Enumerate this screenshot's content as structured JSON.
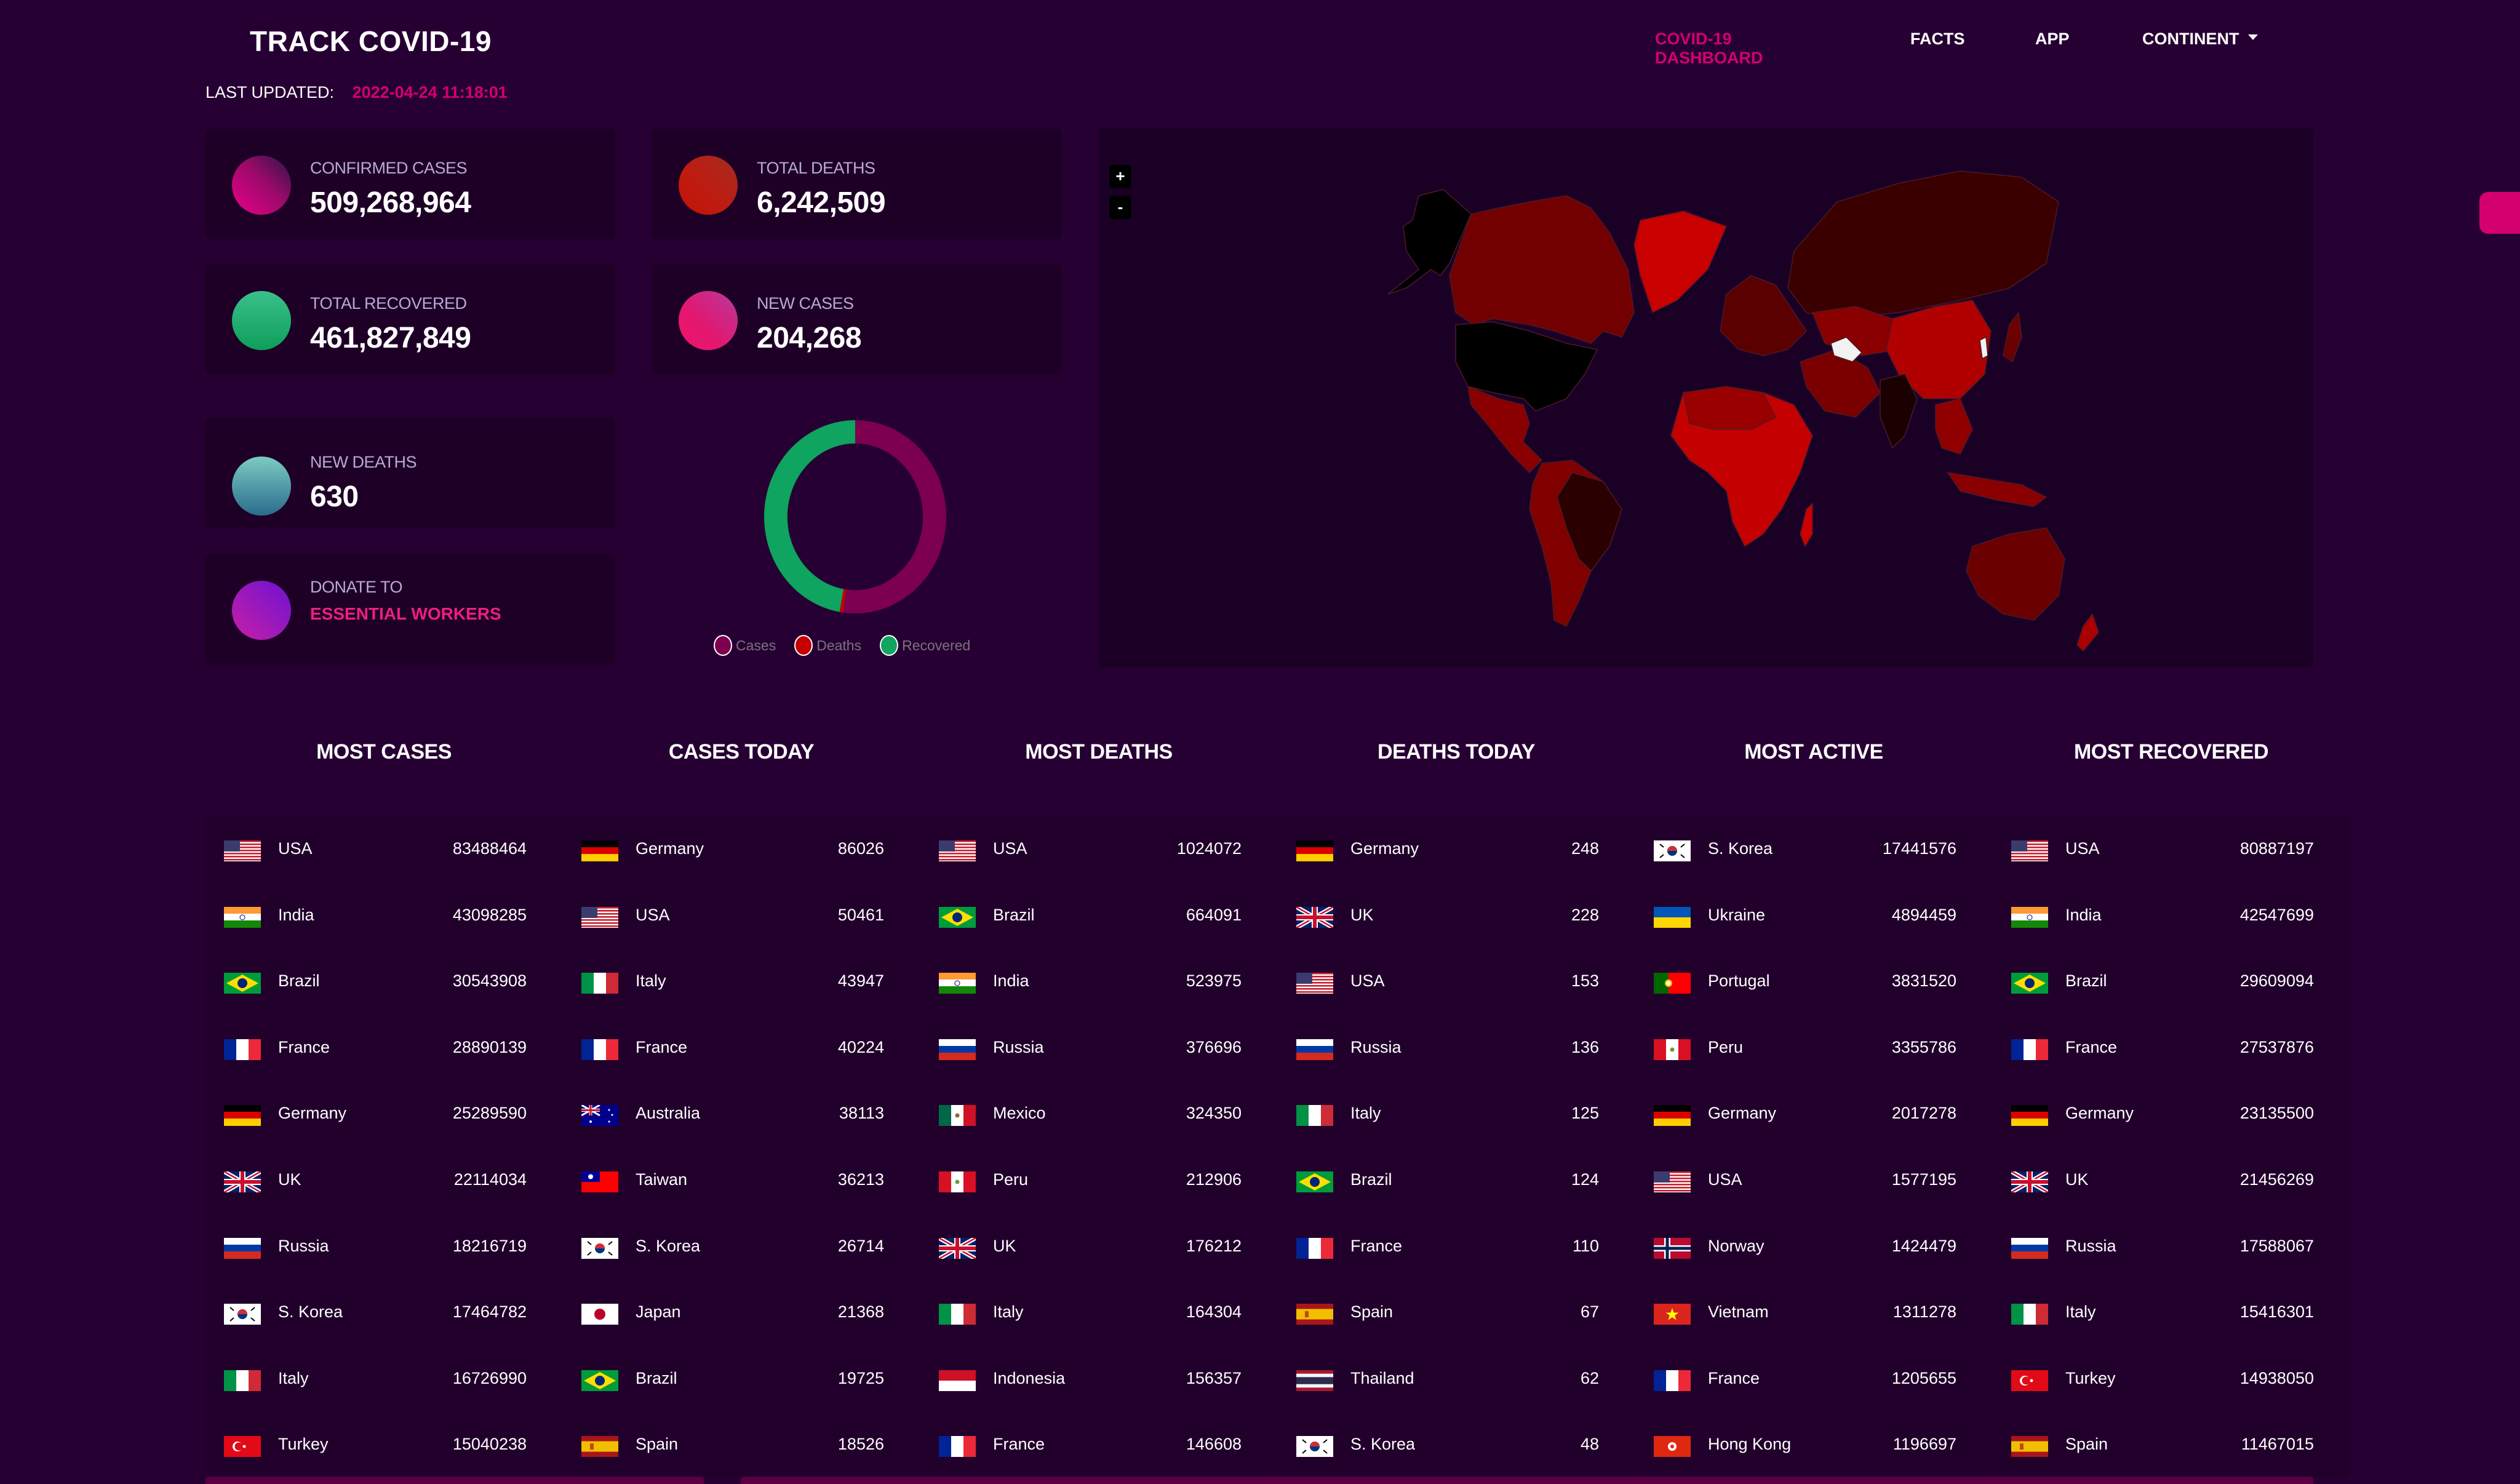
{
  "header": {
    "title": "TRACK COVID-19",
    "last_updated_label": "LAST UPDATED:",
    "last_updated_value": "2022-04-24 11:18:01"
  },
  "nav": [
    {
      "label": "COVID-19 DASHBOARD",
      "active": true
    },
    {
      "label": "FACTS",
      "active": false
    },
    {
      "label": "APP",
      "active": false
    },
    {
      "label": "CONTINENT",
      "active": false,
      "dropdown": true
    }
  ],
  "stats": {
    "confirmed": {
      "label": "CONFIRMED CASES",
      "value": "509,268,964"
    },
    "deaths": {
      "label": "TOTAL DEATHS",
      "value": "6,242,509"
    },
    "recovered": {
      "label": "TOTAL RECOVERED",
      "value": "461,827,849"
    },
    "new_cases": {
      "label": "NEW CASES",
      "value": "204,268"
    },
    "new_deaths": {
      "label": "NEW DEATHS",
      "value": "630"
    },
    "donate": {
      "label": "DONATE TO",
      "link": "ESSENTIAL WORKERS"
    }
  },
  "colors": {
    "accent": "#d4006e",
    "background": "#270033",
    "card": "#1e0026",
    "cases": "#7d0050",
    "deaths": "#c40000",
    "recovered": "#0fa45f"
  },
  "chart_data": {
    "type": "pie",
    "variant": "donut",
    "title": "",
    "legend_position": "bottom",
    "labels": [
      "Cases",
      "Deaths",
      "Recovered"
    ],
    "values": [
      509268964,
      6242509,
      461827849
    ],
    "colors": [
      "#7d0050",
      "#c40000",
      "#0fa45f"
    ]
  },
  "map": {
    "zoom_in_label": "+",
    "zoom_out_label": "-"
  },
  "lists": [
    {
      "title": "MOST CASES",
      "rows": [
        {
          "flag": "us",
          "country": "USA",
          "value": "83488464"
        },
        {
          "flag": "in",
          "country": "India",
          "value": "43098285"
        },
        {
          "flag": "br",
          "country": "Brazil",
          "value": "30543908"
        },
        {
          "flag": "fr",
          "country": "France",
          "value": "28890139"
        },
        {
          "flag": "de",
          "country": "Germany",
          "value": "25289590"
        },
        {
          "flag": "gb",
          "country": "UK",
          "value": "22114034"
        },
        {
          "flag": "ru",
          "country": "Russia",
          "value": "18216719"
        },
        {
          "flag": "kr",
          "country": "S. Korea",
          "value": "17464782"
        },
        {
          "flag": "it",
          "country": "Italy",
          "value": "16726990"
        },
        {
          "flag": "tr",
          "country": "Turkey",
          "value": "15040238"
        }
      ]
    },
    {
      "title": "CASES TODAY",
      "rows": [
        {
          "flag": "de",
          "country": "Germany",
          "value": "86026"
        },
        {
          "flag": "us",
          "country": "USA",
          "value": "50461"
        },
        {
          "flag": "it",
          "country": "Italy",
          "value": "43947"
        },
        {
          "flag": "fr",
          "country": "France",
          "value": "40224"
        },
        {
          "flag": "au",
          "country": "Australia",
          "value": "38113"
        },
        {
          "flag": "tw",
          "country": "Taiwan",
          "value": "36213"
        },
        {
          "flag": "kr",
          "country": "S. Korea",
          "value": "26714"
        },
        {
          "flag": "jp",
          "country": "Japan",
          "value": "21368"
        },
        {
          "flag": "br",
          "country": "Brazil",
          "value": "19725"
        },
        {
          "flag": "es",
          "country": "Spain",
          "value": "18526"
        }
      ]
    },
    {
      "title": "MOST DEATHS",
      "rows": [
        {
          "flag": "us",
          "country": "USA",
          "value": "1024072"
        },
        {
          "flag": "br",
          "country": "Brazil",
          "value": "664091"
        },
        {
          "flag": "in",
          "country": "India",
          "value": "523975"
        },
        {
          "flag": "ru",
          "country": "Russia",
          "value": "376696"
        },
        {
          "flag": "mx",
          "country": "Mexico",
          "value": "324350"
        },
        {
          "flag": "pe",
          "country": "Peru",
          "value": "212906"
        },
        {
          "flag": "gb",
          "country": "UK",
          "value": "176212"
        },
        {
          "flag": "it",
          "country": "Italy",
          "value": "164304"
        },
        {
          "flag": "id",
          "country": "Indonesia",
          "value": "156357"
        },
        {
          "flag": "fr",
          "country": "France",
          "value": "146608"
        }
      ]
    },
    {
      "title": "DEATHS TODAY",
      "rows": [
        {
          "flag": "de",
          "country": "Germany",
          "value": "248"
        },
        {
          "flag": "gb",
          "country": "UK",
          "value": "228"
        },
        {
          "flag": "us",
          "country": "USA",
          "value": "153"
        },
        {
          "flag": "ru",
          "country": "Russia",
          "value": "136"
        },
        {
          "flag": "it",
          "country": "Italy",
          "value": "125"
        },
        {
          "flag": "br",
          "country": "Brazil",
          "value": "124"
        },
        {
          "flag": "fr",
          "country": "France",
          "value": "110"
        },
        {
          "flag": "es",
          "country": "Spain",
          "value": "67"
        },
        {
          "flag": "th",
          "country": "Thailand",
          "value": "62"
        },
        {
          "flag": "kr",
          "country": "S. Korea",
          "value": "48"
        }
      ]
    },
    {
      "title": "MOST ACTIVE",
      "rows": [
        {
          "flag": "kr",
          "country": "S. Korea",
          "value": "17441576"
        },
        {
          "flag": "ua",
          "country": "Ukraine",
          "value": "4894459"
        },
        {
          "flag": "pt",
          "country": "Portugal",
          "value": "3831520"
        },
        {
          "flag": "pe",
          "country": "Peru",
          "value": "3355786"
        },
        {
          "flag": "de",
          "country": "Germany",
          "value": "2017278"
        },
        {
          "flag": "us",
          "country": "USA",
          "value": "1577195"
        },
        {
          "flag": "no",
          "country": "Norway",
          "value": "1424479"
        },
        {
          "flag": "vn",
          "country": "Vietnam",
          "value": "1311278"
        },
        {
          "flag": "fr",
          "country": "France",
          "value": "1205655"
        },
        {
          "flag": "hk",
          "country": "Hong Kong",
          "value": "1196697"
        }
      ]
    },
    {
      "title": "MOST RECOVERED",
      "rows": [
        {
          "flag": "us",
          "country": "USA",
          "value": "80887197"
        },
        {
          "flag": "in",
          "country": "India",
          "value": "42547699"
        },
        {
          "flag": "br",
          "country": "Brazil",
          "value": "29609094"
        },
        {
          "flag": "fr",
          "country": "France",
          "value": "27537876"
        },
        {
          "flag": "de",
          "country": "Germany",
          "value": "23135500"
        },
        {
          "flag": "gb",
          "country": "UK",
          "value": "21456269"
        },
        {
          "flag": "ru",
          "country": "Russia",
          "value": "17588067"
        },
        {
          "flag": "it",
          "country": "Italy",
          "value": "15416301"
        },
        {
          "flag": "tr",
          "country": "Turkey",
          "value": "14938050"
        },
        {
          "flag": "es",
          "country": "Spain",
          "value": "11467015"
        }
      ]
    }
  ]
}
